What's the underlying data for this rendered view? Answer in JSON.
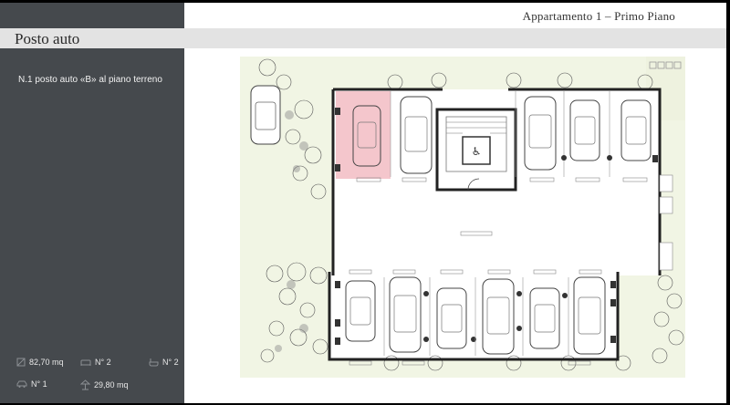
{
  "header": {
    "title": "Appartamento 1 – Primo Piano"
  },
  "section": {
    "title": "Posto auto"
  },
  "sidebar": {
    "description": "N.1 posto auto «B» al piano terreno",
    "stats": [
      {
        "icon": "area-icon",
        "value": "82,70 mq"
      },
      {
        "icon": "rooms-icon",
        "value": "N° 2"
      },
      {
        "icon": "bath-icon",
        "value": "N° 2"
      },
      {
        "icon": "car-icon",
        "value": "N° 1"
      },
      {
        "icon": "terrace-icon",
        "value": "29,80 mq"
      }
    ]
  },
  "floorplan": {
    "highlight_color": "#f4c6cc",
    "label": "posto auto B"
  }
}
